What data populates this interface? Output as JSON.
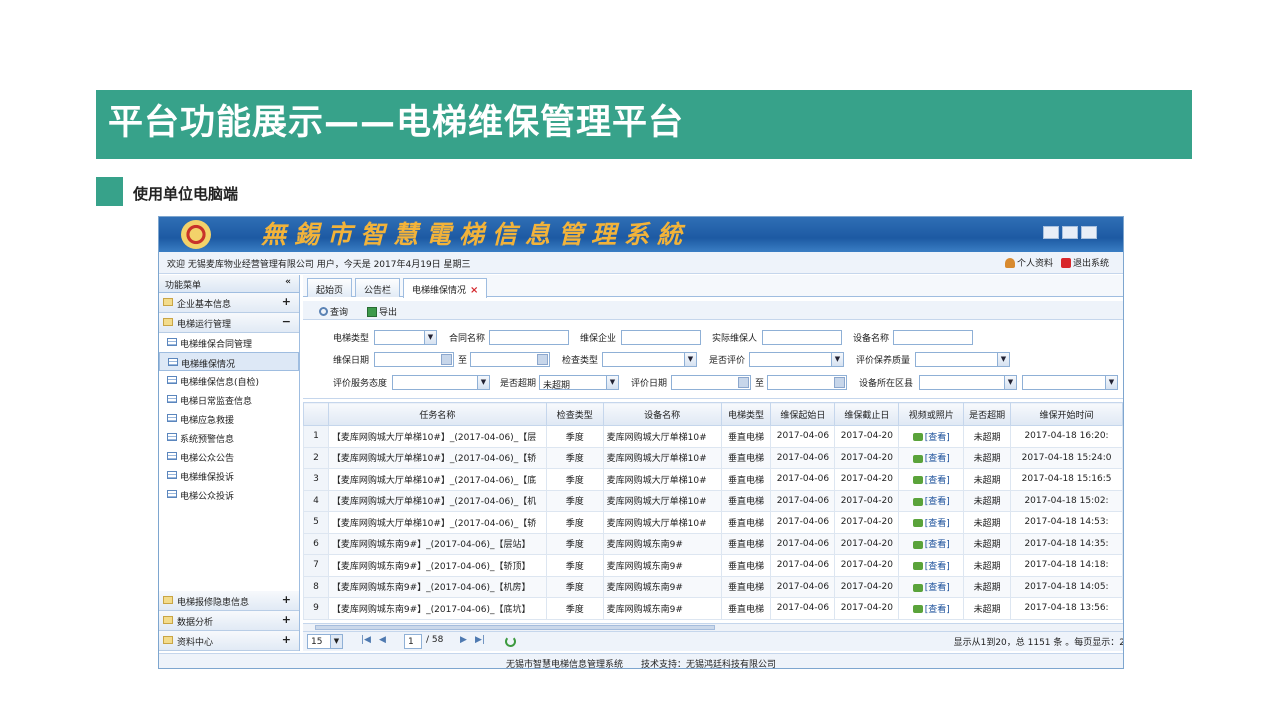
{
  "slide": {
    "title": "平台功能展示——电梯维保管理平台",
    "subtitle": "使用单位电脑端",
    "accent_color": "#37a28a"
  },
  "app": {
    "banner_title": "無錫市智慧電梯信息管理系統",
    "welcome": "欢迎 无锡麦库物业经营管理有限公司 用户，今天是 2017年4月19日 星期三",
    "profile_link": "个人资料",
    "logout_link": "退出系统",
    "footer": "无锡市智慧电梯信息管理系统　　技术支持：无锡鸿廷科技有限公司"
  },
  "sidebar": {
    "header": "功能菜单",
    "collapse": "«",
    "groups": [
      {
        "label": "企业基本信息",
        "toggle": "+"
      },
      {
        "label": "电梯运行管理",
        "toggle": "−"
      }
    ],
    "items": [
      "电梯维保合同管理",
      "电梯维保情况",
      "电梯维保信息(自检)",
      "电梯日常监查信息",
      "电梯应急救援",
      "系统预警信息",
      "电梯公众公告",
      "电梯维保投诉",
      "电梯公众投诉"
    ],
    "bottom_groups": [
      {
        "label": "电梯报修隐患信息",
        "toggle": "+"
      },
      {
        "label": "数据分析",
        "toggle": "+"
      },
      {
        "label": "资料中心",
        "toggle": "+"
      }
    ]
  },
  "tabs": [
    {
      "label": "起始页"
    },
    {
      "label": "公告栏"
    },
    {
      "label": "电梯维保情况",
      "close": "×"
    }
  ],
  "toolbar": {
    "query": "查询",
    "export": "导出"
  },
  "filters": {
    "elevator_type": "电梯类型",
    "contract_name": "合同名称",
    "maint_company": "维保企业",
    "actual_maintainer": "实际维保人",
    "device_name": "设备名称",
    "maint_date": "维保日期",
    "to": "至",
    "check_type": "检查类型",
    "is_evaluated": "是否评价",
    "eval_quality": "评价保养质量",
    "eval_attitude": "评价服务态度",
    "is_overdue": "是否超期",
    "is_overdue_value": "未超期",
    "eval_date": "评价日期",
    "to2": "至",
    "device_district": "设备所在区县"
  },
  "grid": {
    "columns": [
      "",
      "任务名称",
      "检查类型",
      "设备名称",
      "电梯类型",
      "维保起始日",
      "维保截止日",
      "视频或照片",
      "是否超期",
      "维保开始时间"
    ],
    "rows": [
      [
        "1",
        "【麦库网购城大厅单梯10#】_(2017-04-06)_【层",
        "季度",
        "麦库网购城大厅单梯10#",
        "垂直电梯",
        "2017-04-06",
        "2017-04-20",
        "[查看]",
        "未超期",
        "2017-04-18 16:20:"
      ],
      [
        "2",
        "【麦库网购城大厅单梯10#】_(2017-04-06)_【轿",
        "季度",
        "麦库网购城大厅单梯10#",
        "垂直电梯",
        "2017-04-06",
        "2017-04-20",
        "[查看]",
        "未超期",
        "2017-04-18 15:24:0"
      ],
      [
        "3",
        "【麦库网购城大厅单梯10#】_(2017-04-06)_【底",
        "季度",
        "麦库网购城大厅单梯10#",
        "垂直电梯",
        "2017-04-06",
        "2017-04-20",
        "[查看]",
        "未超期",
        "2017-04-18 15:16:5"
      ],
      [
        "4",
        "【麦库网购城大厅单梯10#】_(2017-04-06)_【机",
        "季度",
        "麦库网购城大厅单梯10#",
        "垂直电梯",
        "2017-04-06",
        "2017-04-20",
        "[查看]",
        "未超期",
        "2017-04-18 15:02:"
      ],
      [
        "5",
        "【麦库网购城大厅单梯10#】_(2017-04-06)_【轿",
        "季度",
        "麦库网购城大厅单梯10#",
        "垂直电梯",
        "2017-04-06",
        "2017-04-20",
        "[查看]",
        "未超期",
        "2017-04-18 14:53:"
      ],
      [
        "6",
        "【麦库网购城东南9#】_(2017-04-06)_【层站】",
        "季度",
        "麦库网购城东南9#",
        "垂直电梯",
        "2017-04-06",
        "2017-04-20",
        "[查看]",
        "未超期",
        "2017-04-18 14:35:"
      ],
      [
        "7",
        "【麦库网购城东南9#】_(2017-04-06)_【轿顶】",
        "季度",
        "麦库网购城东南9#",
        "垂直电梯",
        "2017-04-06",
        "2017-04-20",
        "[查看]",
        "未超期",
        "2017-04-18 14:18:"
      ],
      [
        "8",
        "【麦库网购城东南9#】_(2017-04-06)_【机房】",
        "季度",
        "麦库网购城东南9#",
        "垂直电梯",
        "2017-04-06",
        "2017-04-20",
        "[查看]",
        "未超期",
        "2017-04-18 14:05:"
      ],
      [
        "9",
        "【麦库网购城东南9#】_(2017-04-06)_【底坑】",
        "季度",
        "麦库网购城东南9#",
        "垂直电梯",
        "2017-04-06",
        "2017-04-20",
        "[查看]",
        "未超期",
        "2017-04-18 13:56:"
      ]
    ]
  },
  "pager": {
    "page_size": "15",
    "current_page": "1",
    "total_pages": "/ 58",
    "summary": "显示从1到20，总 1151 条 。每页显示：2"
  }
}
